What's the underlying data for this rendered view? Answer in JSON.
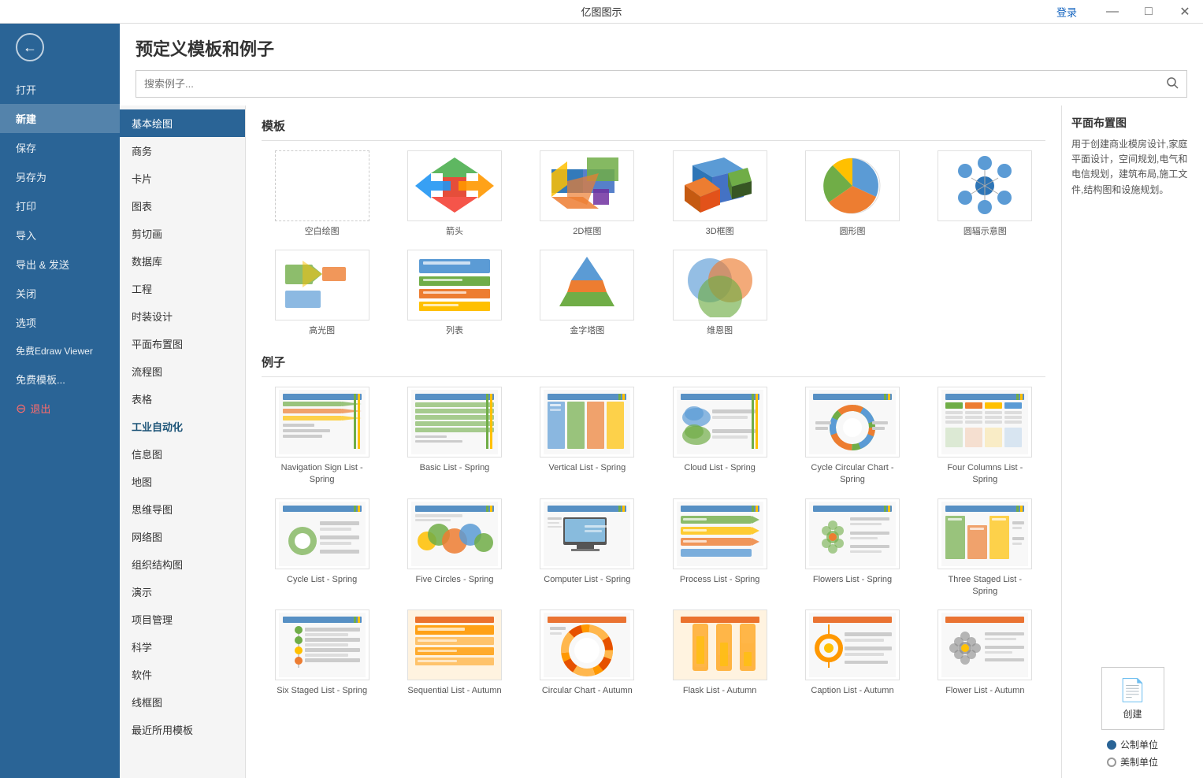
{
  "titlebar": {
    "title": "亿图图示",
    "login": "登录",
    "controls": [
      "—",
      "□",
      "×"
    ]
  },
  "sidebar": {
    "back_icon": "←",
    "items": [
      {
        "label": "打开",
        "key": "open",
        "active": false
      },
      {
        "label": "新建",
        "key": "new",
        "active": true
      },
      {
        "label": "保存",
        "key": "save",
        "active": false
      },
      {
        "label": "另存为",
        "key": "save-as",
        "active": false
      },
      {
        "label": "打印",
        "key": "print",
        "active": false
      },
      {
        "label": "导入",
        "key": "import",
        "active": false
      },
      {
        "label": "导出 & 发送",
        "key": "export",
        "active": false
      },
      {
        "label": "关闭",
        "key": "close",
        "active": false
      },
      {
        "label": "选项",
        "key": "options",
        "active": false
      },
      {
        "label": "免费Edraw Viewer",
        "key": "edraw-viewer",
        "active": false
      },
      {
        "label": "免费模板...",
        "key": "free-templates",
        "active": false
      },
      {
        "label": "退出",
        "key": "exit",
        "active": false,
        "danger": true
      }
    ]
  },
  "header": {
    "title": "预定义模板和例子",
    "search_placeholder": "搜索例子..."
  },
  "categories": [
    {
      "label": "基本绘图",
      "key": "basic",
      "active": true
    },
    {
      "label": "商务",
      "key": "business"
    },
    {
      "label": "卡片",
      "key": "card"
    },
    {
      "label": "图表",
      "key": "chart"
    },
    {
      "label": "剪切画",
      "key": "clipart"
    },
    {
      "label": "数据库",
      "key": "database"
    },
    {
      "label": "工程",
      "key": "engineering"
    },
    {
      "label": "时装设计",
      "key": "fashion"
    },
    {
      "label": "平面布置图",
      "key": "floorplan"
    },
    {
      "label": "流程图",
      "key": "flowchart"
    },
    {
      "label": "表格",
      "key": "table"
    },
    {
      "label": "工业自动化",
      "key": "industrial",
      "bold_blue": true
    },
    {
      "label": "信息图",
      "key": "infographic"
    },
    {
      "label": "地图",
      "key": "map"
    },
    {
      "label": "思维导图",
      "key": "mindmap"
    },
    {
      "label": "网络图",
      "key": "network"
    },
    {
      "label": "组织结构图",
      "key": "org"
    },
    {
      "label": "演示",
      "key": "presentation"
    },
    {
      "label": "项目管理",
      "key": "project"
    },
    {
      "label": "科学",
      "key": "science"
    },
    {
      "label": "软件",
      "key": "software"
    },
    {
      "label": "线框图",
      "key": "wireframe"
    },
    {
      "label": "最近所用模板",
      "key": "recent"
    }
  ],
  "templates_section": {
    "title": "模板",
    "items": [
      {
        "label": "空白绘图",
        "key": "blank",
        "type": "blank"
      },
      {
        "label": "箭头",
        "key": "arrow",
        "type": "arrow"
      },
      {
        "label": "2D框图",
        "key": "2d",
        "type": "2d"
      },
      {
        "label": "3D框图",
        "key": "3d",
        "type": "3d"
      },
      {
        "label": "圆形图",
        "key": "circle",
        "type": "circle"
      },
      {
        "label": "圆辐示意图",
        "key": "radial",
        "type": "radial"
      },
      {
        "label": "高光图",
        "key": "highlight",
        "type": "highlight"
      },
      {
        "label": "列表",
        "key": "list",
        "type": "list"
      },
      {
        "label": "金字塔图",
        "key": "pyramid",
        "type": "pyramid"
      },
      {
        "label": "维恩图",
        "key": "venn",
        "type": "venn"
      }
    ]
  },
  "examples_section": {
    "title": "例子",
    "items": [
      {
        "label": "Navigation Sign List - Spring",
        "key": "nav-sign"
      },
      {
        "label": "Basic List - Spring",
        "key": "basic-list"
      },
      {
        "label": "Vertical List - Spring",
        "key": "vertical-list"
      },
      {
        "label": "Cloud List - Spring",
        "key": "cloud-list"
      },
      {
        "label": "Cycle Circular Chart - Spring",
        "key": "cycle-chart"
      },
      {
        "label": "Four Columns List - Spring",
        "key": "four-columns"
      },
      {
        "label": "Cycle List - Spring",
        "key": "cycle-list"
      },
      {
        "label": "Five Circles - Spring",
        "key": "five-circles"
      },
      {
        "label": "Computer List - Spring",
        "key": "computer-list"
      },
      {
        "label": "Process List - Spring",
        "key": "process-list"
      },
      {
        "label": "Flowers List - Spring",
        "key": "flowers-list"
      },
      {
        "label": "Three Staged List - Spring",
        "key": "three-staged"
      },
      {
        "label": "Six Staged List - Spring",
        "key": "six-staged"
      },
      {
        "label": "Sequential List - Autumn",
        "key": "sequential"
      },
      {
        "label": "Circular Chart - Autumn",
        "key": "circular-chart"
      },
      {
        "label": "Flask List - Autumn",
        "key": "flask-list"
      },
      {
        "label": "Caption List - Autumn",
        "key": "caption-list"
      },
      {
        "label": "Flower List - Autumn",
        "key": "flower-list"
      }
    ]
  },
  "right_panel": {
    "title": "平面布置图",
    "description": "用于创建商业模房设计,家庭平面设计，空间规划,电气和电信规划，建筑布局,施工文件,结构图和设施规划。",
    "create_label": "创建",
    "units": [
      {
        "label": "公制单位",
        "selected": true
      },
      {
        "label": "美制单位",
        "selected": false
      }
    ]
  }
}
